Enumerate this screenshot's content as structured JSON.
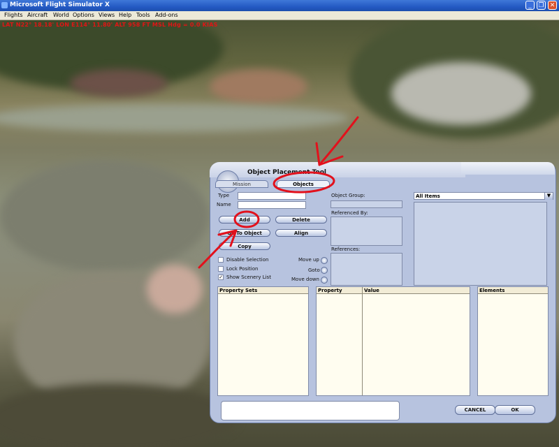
{
  "window": {
    "title": "Microsoft Flight Simulator X",
    "controls": {
      "minimize": "_",
      "restore": "❐",
      "close": "✕"
    }
  },
  "menu": [
    "Flights",
    "Aircraft",
    "World",
    "Options",
    "Views",
    "Help",
    "Tools",
    "Add-ons"
  ],
  "status_line": "LAT N22° 18.18' LON E114° 11.80' ALT 958 FT MSL Hdg = 0.0 KIAS",
  "dialog": {
    "title": "Object Placement Tool",
    "tabs": [
      "Mission",
      "Objects"
    ],
    "active_tab": "Objects",
    "fields": {
      "type_label": "Type",
      "type_value": "",
      "name_label": "Name",
      "name_value": ""
    },
    "buttons": {
      "add": "Add",
      "delete": "Delete",
      "go_to_object": "Go To Object",
      "align": "Align",
      "copy": "Copy",
      "cancel": "CANCEL",
      "ok": "OK"
    },
    "checkboxes": [
      {
        "label": "Disable Selection",
        "checked": false
      },
      {
        "label": "Lock Position",
        "checked": false
      },
      {
        "label": "Show Scenery List",
        "checked": true
      }
    ],
    "move": {
      "up": "Move up",
      "goto": "Goto",
      "down": "Move down"
    },
    "labels": {
      "object_group": "Object Group:",
      "referenced_by": "Referenced By:",
      "references": "References:"
    },
    "dropdown": {
      "selected": "All Items"
    },
    "tables": {
      "property_sets": "Property Sets",
      "property": "Property",
      "value": "Value",
      "elements": "Elements"
    },
    "status_field": ""
  },
  "colors": {
    "annotation": "#e2111c",
    "status_text": "#e01515",
    "dialog_bg": "#b7c3df"
  }
}
